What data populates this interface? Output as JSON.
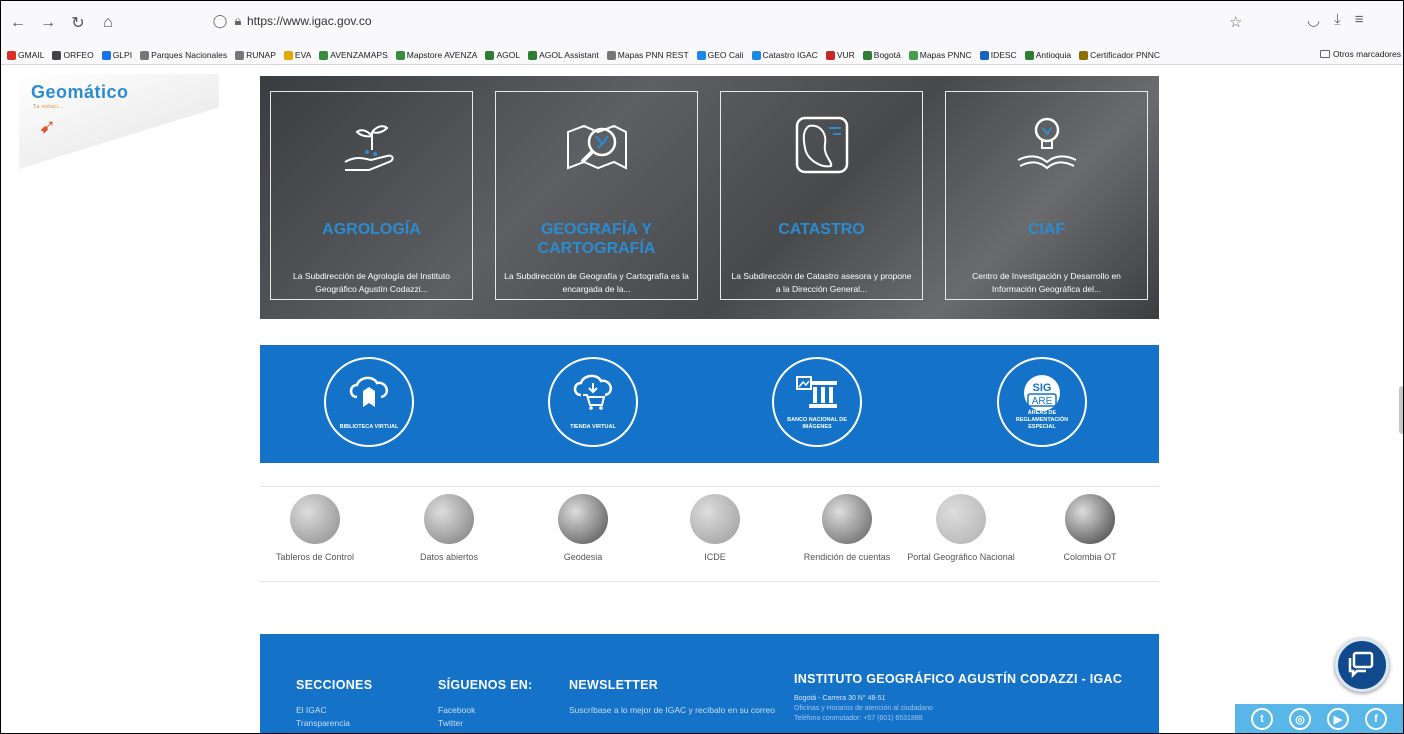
{
  "browser": {
    "url": "https://www.igac.gov.co",
    "bookmarks": [
      "GMAIL",
      "ORFEO",
      "GLPI",
      "Parques Nacionales",
      "RUNAP",
      "EVA",
      "AVENZAMAPS",
      "Mapstore AVENZA",
      "AGOL",
      "AGOL Assistant",
      "Mapas PNN REST",
      "GEO Cali",
      "Catastro IGAC",
      "VUR",
      "Bogotá",
      "Mapas PNNC",
      "IDESC",
      "Antioquia",
      "Certificador PNNC"
    ],
    "other_bookmarks": "Otros marcadores"
  },
  "logo": {
    "name": "Geomático",
    "tagline": "Tu soluci...",
    "colors": {
      "brand": "#2c8ccf",
      "accent": "#e07a20"
    }
  },
  "hero_cards": [
    {
      "title": "AGROLOGÍA",
      "desc": "La Subdirección de Agrología del Instituto Geográfico Agustín Codazzi...",
      "icon": "plant-hand-icon"
    },
    {
      "title": "GEOGRAFÍA Y CARTOGRAFÍA",
      "desc": "La Subdirección de Geografía y Cartografía es la encargada de la...",
      "icon": "map-magnifier-icon"
    },
    {
      "title": "CATASTRO",
      "desc": "La Subdirección de Catastro asesora y propone a la Dirección General...",
      "icon": "parcel-map-icon"
    },
    {
      "title": "CIAF",
      "desc": "Centro de Investigación y Desarrollo en Información Geográfica del...",
      "icon": "lightbulb-book-icon"
    }
  ],
  "services": [
    {
      "label": "BIBLIOTECA VIRTUAL",
      "icon": "cloud-book-icon"
    },
    {
      "label": "TIENDA VIRTUAL",
      "icon": "cloud-cart-icon"
    },
    {
      "label": "BANCO NACIONAL DE IMÁGENES",
      "icon": "bank-image-icon"
    },
    {
      "label": "ÁREAS DE REGLAMENTACIÓN ESPECIAL",
      "icon": "sig-are-icon",
      "badge_top": "SIG",
      "badge_bottom": "ARE"
    }
  ],
  "portals": [
    {
      "label": "Tableros de Control",
      "color": "#8a8a8a"
    },
    {
      "label": "Datos abiertos",
      "color": "#7a7a7a"
    },
    {
      "label": "Geodesia",
      "color": "#4a4a4a"
    },
    {
      "label": "ICDE",
      "color": "#9a9a9a"
    },
    {
      "label": "Rendición de cuentas",
      "color": "#5c5c5c"
    },
    {
      "label": "Portal Geográfico Nacional",
      "color": "#b0b0b0"
    },
    {
      "label": "Colombia OT",
      "color": "#3a3a3a"
    }
  ],
  "footer": {
    "sections_title": "SECCIONES",
    "sections_items": [
      "El IGAC",
      "Transparencia"
    ],
    "follow_title": "SÍGUENOS EN:",
    "follow_items": [
      "Facebook",
      "Twitter"
    ],
    "newsletter_title": "NEWSLETTER",
    "newsletter_text": "Suscríbase a lo mejor de IGAC y recíbalo en su correo",
    "org_title": "INSTITUTO GEOGRÁFICO AGUSTÍN CODAZZI - IGAC",
    "org_lines": [
      "Bogotá - Carrera 30 N° 48-51",
      "Oficinas y Horarios de atención al ciudadano",
      "Teléfono conmutador: +57 (601) 6531888"
    ]
  },
  "social": [
    "twitter-icon",
    "instagram-icon",
    "youtube-icon",
    "facebook-icon"
  ]
}
